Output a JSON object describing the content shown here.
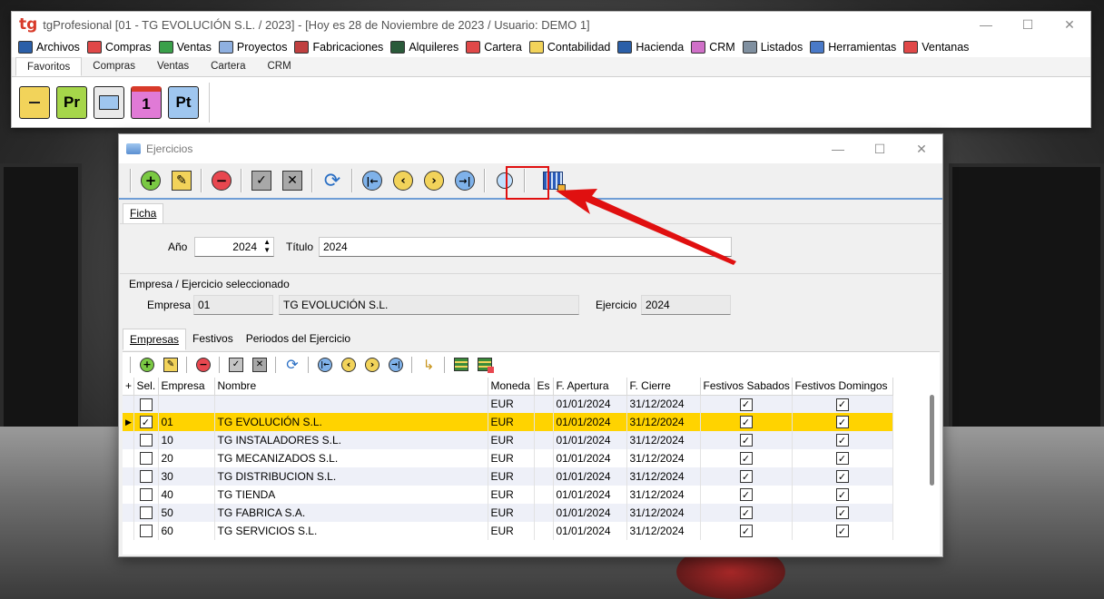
{
  "app": {
    "logo": "tg",
    "title": "tgProfesional [01 - TG EVOLUCIÓN S.L. / 2023] - [Hoy es 28 de Noviembre de 2023 / Usuario: DEMO 1]",
    "menu": [
      "Archivos",
      "Compras",
      "Ventas",
      "Proyectos",
      "Fabricaciones",
      "Alquileres",
      "Cartera",
      "Contabilidad",
      "Hacienda",
      "CRM",
      "Listados",
      "Herramientas",
      "Ventanas"
    ],
    "ribbon_tabs": [
      "Favoritos",
      "Compras",
      "Ventas",
      "Cartera",
      "CRM"
    ],
    "ribbon_buttons": [
      "",
      "Pr",
      "",
      "1",
      "Pt"
    ]
  },
  "dialog": {
    "title": "Ejercicios",
    "tab_ficha": "Ficha",
    "ano_label": "Año",
    "ano_value": "2024",
    "titulo_label": "Título",
    "titulo_value": "2024",
    "group_title": "Empresa / Ejercicio seleccionado",
    "empresa_label": "Empresa",
    "empresa_code": "01",
    "empresa_name": "TG EVOLUCIÓN S.L.",
    "ejercicio_label": "Ejercicio",
    "ejercicio_value": "2024",
    "tabs": [
      "Empresas",
      "Festivos",
      "Periodos del Ejercicio"
    ]
  },
  "grid": {
    "columns": [
      "+",
      "Sel.",
      "Empresa",
      "Nombre",
      "Moneda",
      "Es",
      "F. Apertura",
      "F. Cierre",
      "Festivos Sabados",
      "Festivos Domingos"
    ],
    "rows": [
      {
        "sel": false,
        "empresa": "",
        "nombre": "",
        "moneda": "EUR",
        "apertura": "01/01/2024",
        "cierre": "31/12/2024",
        "sab": true,
        "dom": true
      },
      {
        "sel": true,
        "empresa": "01",
        "nombre": "TG EVOLUCIÓN S.L.",
        "moneda": "EUR",
        "apertura": "01/01/2024",
        "cierre": "31/12/2024",
        "sab": true,
        "dom": true
      },
      {
        "sel": false,
        "empresa": "10",
        "nombre": "TG INSTALADORES S.L.",
        "moneda": "EUR",
        "apertura": "01/01/2024",
        "cierre": "31/12/2024",
        "sab": true,
        "dom": true
      },
      {
        "sel": false,
        "empresa": "20",
        "nombre": "TG MECANIZADOS S.L.",
        "moneda": "EUR",
        "apertura": "01/01/2024",
        "cierre": "31/12/2024",
        "sab": true,
        "dom": true
      },
      {
        "sel": false,
        "empresa": "30",
        "nombre": "TG DISTRIBUCION S.L.",
        "moneda": "EUR",
        "apertura": "01/01/2024",
        "cierre": "31/12/2024",
        "sab": true,
        "dom": true
      },
      {
        "sel": false,
        "empresa": "40",
        "nombre": "TG TIENDA",
        "moneda": "EUR",
        "apertura": "01/01/2024",
        "cierre": "31/12/2024",
        "sab": true,
        "dom": true
      },
      {
        "sel": false,
        "empresa": "50",
        "nombre": " TG FABRICA S.A.",
        "moneda": "EUR",
        "apertura": "01/01/2024",
        "cierre": "31/12/2024",
        "sab": true,
        "dom": true
      },
      {
        "sel": false,
        "empresa": "60",
        "nombre": "TG SERVICIOS S.L.",
        "moneda": "EUR",
        "apertura": "01/01/2024",
        "cierre": "31/12/2024",
        "sab": true,
        "dom": true
      }
    ]
  },
  "colors": {
    "selected_row": "#ffd300",
    "annotation": "#e01010",
    "toolbar_accent": "#6f9ed6"
  }
}
